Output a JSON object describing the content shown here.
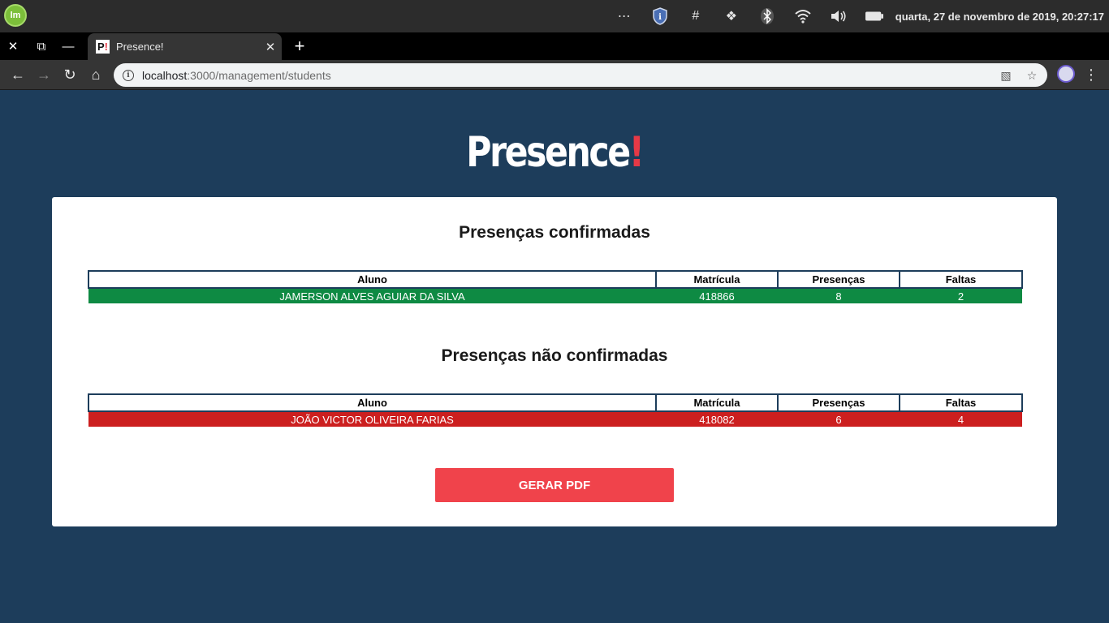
{
  "os": {
    "clock": "quarta, 27 de novembro de 2019, 20:27:17",
    "launcher_label": "lm"
  },
  "browser": {
    "tab_title": "Presence!",
    "favicon_text": "P",
    "favicon_bang": "!",
    "url_host": "localhost",
    "url_rest": ":3000/management/students"
  },
  "page": {
    "logo_text": "Presence",
    "logo_bang": "!",
    "confirmed": {
      "title": "Presenças confirmadas",
      "columns": [
        "Aluno",
        "Matrícula",
        "Presenças",
        "Faltas"
      ],
      "rows": [
        {
          "name": "JAMERSON ALVES AGUIAR DA SILVA",
          "id": "418866",
          "presences": "8",
          "absences": "2"
        }
      ]
    },
    "unconfirmed": {
      "title": "Presenças não confirmadas",
      "columns": [
        "Aluno",
        "Matrícula",
        "Presenças",
        "Faltas"
      ],
      "rows": [
        {
          "name": "JOÃO VICTOR OLIVEIRA FARIAS",
          "id": "418082",
          "presences": "6",
          "absences": "4"
        }
      ]
    },
    "pdf_button": "GERAR PDF"
  },
  "colors": {
    "background": "#1d3d5b",
    "confirmed_row": "#0e8a43",
    "unconfirmed_row": "#cc1f1f",
    "button": "#f0434b",
    "brand_accent": "#e63946"
  }
}
